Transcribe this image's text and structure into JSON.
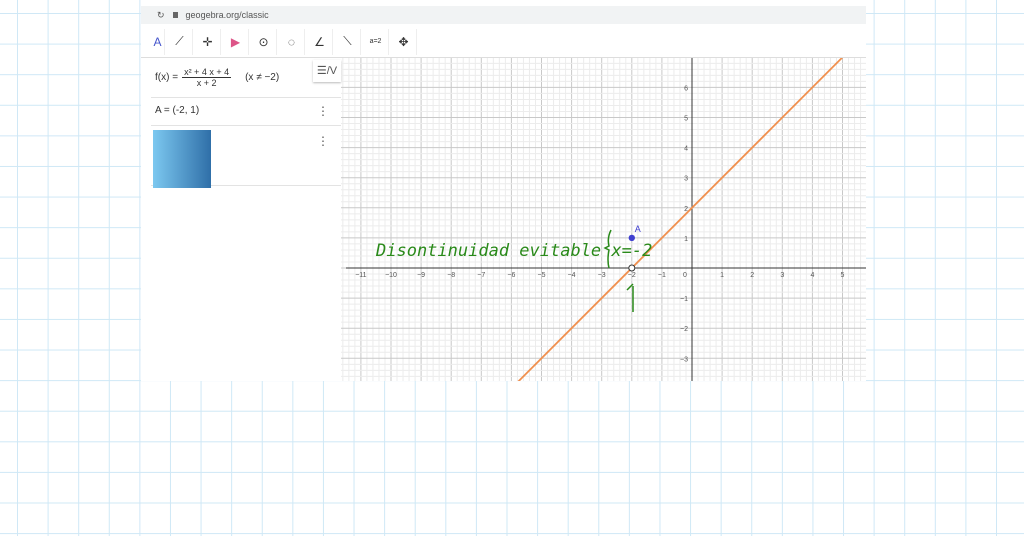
{
  "browser": {
    "url": "geogebra.org/classic"
  },
  "toolbar": {
    "tools": [
      "move",
      "line",
      "perpendicular",
      "polygon",
      "circle-center",
      "circle-3pts",
      "angle",
      "reflect",
      "slider",
      "move-graphics"
    ],
    "slider_label": "a=2"
  },
  "algebra": {
    "f_lhs": "f(x) =",
    "f_num": "x² + 4 x + 4",
    "f_den": "x + 2",
    "f_cond": "(x ≠ −2)",
    "point": "A = (-2, 1)",
    "menu": "⋮",
    "toggle": "☰/V"
  },
  "graph": {
    "function": "f(x)=x+2, x≠-2",
    "line_color": "#f0904f",
    "point_color": "#3f3fd0",
    "point_label": "A",
    "point": [
      -2,
      1
    ],
    "hole": [
      -2,
      0
    ],
    "x_ticks": [
      -11,
      -10,
      -9,
      -8,
      -7,
      -6,
      -5,
      -4,
      -3,
      -2,
      -1,
      0,
      1,
      2,
      3,
      4,
      5
    ],
    "y_ticks": [
      -3,
      -2,
      -1,
      1,
      2,
      3,
      4,
      5,
      6
    ]
  },
  "annotation": {
    "text": "Disontinuidad evitable x=-2",
    "color": "#2a8a1a"
  }
}
